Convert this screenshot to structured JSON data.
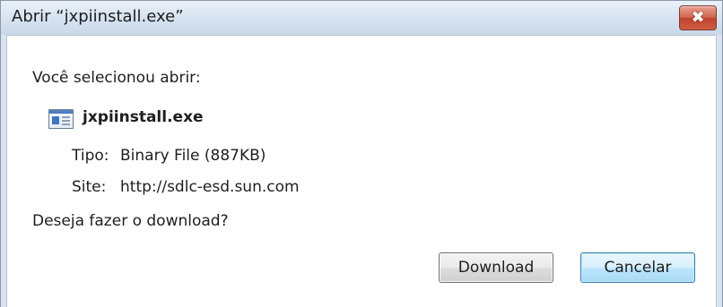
{
  "window": {
    "title": "Abrir “jxpiinstall.exe”",
    "close_glyph": "✖"
  },
  "dialog": {
    "intro": "Você selecionou abrir:",
    "file_icon": "document-window-icon",
    "filename": "jxpiinstall.exe",
    "type_label": "Tipo:",
    "type_value": "Binary File (887KB)",
    "site_label": "Site:",
    "site_value": "http://sdlc-esd.sun.com",
    "question": "Deseja fazer o download?"
  },
  "buttons": {
    "download": "Download",
    "cancel": "Cancelar"
  },
  "colors": {
    "close_button": "#c1412c",
    "focused_button_border": "#3c7fb1"
  }
}
